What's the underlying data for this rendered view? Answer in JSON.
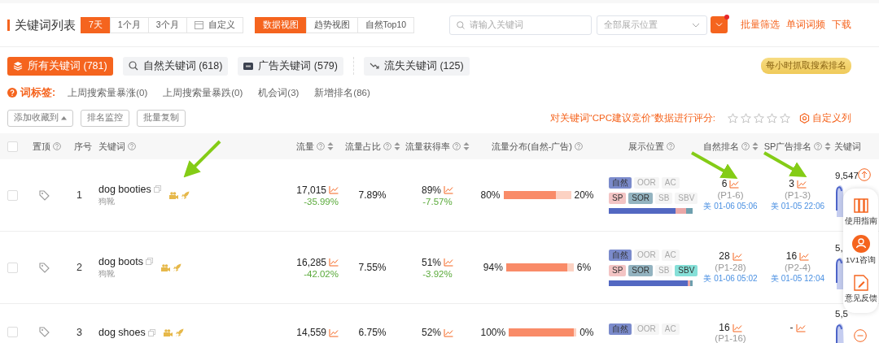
{
  "header": {
    "title": "关键词列表",
    "date_tabs": [
      {
        "label": "7天",
        "selected": true
      },
      {
        "label": "1个月",
        "selected": false
      },
      {
        "label": "3个月",
        "selected": false
      },
      {
        "label": "自定义",
        "selected": false,
        "kind": "calendar"
      }
    ],
    "view_tabs": [
      {
        "label": "数据视图",
        "selected": true
      },
      {
        "label": "趋势视图",
        "selected": false
      },
      {
        "label": "自然Top10",
        "selected": false
      }
    ],
    "search": {
      "placeholder": "请输入关键词"
    },
    "position_select": {
      "placeholder": "全部展示位置"
    },
    "filter_button": {
      "badge": true
    },
    "links": [
      "批量筛选",
      "单词词频",
      "下载"
    ]
  },
  "categories": [
    {
      "label": "所有关键词 (781)",
      "selected": true,
      "kind": "layers"
    },
    {
      "label": "自然关键词 (618)",
      "selected": false,
      "kind": "search"
    },
    {
      "label": "广告关键词 (579)",
      "selected": false,
      "kind": "ad"
    },
    {
      "label": "流失关键词 (125)",
      "selected": false,
      "kind": "loss"
    }
  ],
  "hourly_badge": "每小时抓取搜索排名",
  "word_tags": {
    "label": "词标签:",
    "items": [
      "上周搜索量暴涨(0)",
      "上周搜索量暴跌(0)",
      "机会词(3)",
      "新增排名(86)"
    ]
  },
  "actions": [
    {
      "label": "添加收藏到",
      "kind": "dropdown"
    },
    {
      "label": "排名监控",
      "kind": "plain"
    },
    {
      "label": "批量复制",
      "kind": "plain"
    }
  ],
  "rating": {
    "label": "对关键词“CPC建议竞价”数据进行评分:",
    "stars": 0
  },
  "custom_columns": "自定义列",
  "table": {
    "select_all": false,
    "columns": [
      {
        "label": "置顶",
        "help": true,
        "sortable": false
      },
      {
        "label": "序号",
        "help": false,
        "sortable": false
      },
      {
        "label": "关键词",
        "help": true,
        "sortable": false
      },
      {
        "label": "流量",
        "help": true,
        "sortable": true
      },
      {
        "label": "流量占比",
        "help": true,
        "sortable": true
      },
      {
        "label": "流量获得率",
        "help": true,
        "sortable": true
      },
      {
        "label": "流量分布(自然-广告)",
        "help": true,
        "sortable": false
      },
      {
        "label": "展示位置",
        "help": true,
        "sortable": false
      },
      {
        "label": "自然排名",
        "help": true,
        "sortable": true
      },
      {
        "label": "SP广告排名",
        "help": true,
        "sortable": true
      },
      {
        "label": "关键词",
        "help": false,
        "sortable": false
      }
    ],
    "rows": [
      {
        "checked": false,
        "index": "1",
        "keyword": "dog booties",
        "translation": "狗靴",
        "traffic": {
          "value": "17,015",
          "change": "-35.99%"
        },
        "traffic_share": "7.89%",
        "acquisition": {
          "value": "89%",
          "change": "-7.57%"
        },
        "distribution": {
          "natural": "80%",
          "ad": "20%",
          "level": 0.8
        },
        "positions": {
          "tags": [
            [
              {
                "label": "自然",
                "on": true,
                "color": "#7b8bcc"
              },
              {
                "label": "OOR",
                "on": false
              },
              {
                "label": "AC",
                "on": false
              }
            ],
            [
              {
                "label": "SP",
                "on": true,
                "color": "#f3c4c4"
              },
              {
                "label": "SOR",
                "on": true,
                "color": "#93b3c0"
              },
              {
                "label": "SB",
                "on": false
              },
              {
                "label": "SBV",
                "on": false
              }
            ]
          ],
          "bar": {
            "color": "#6e9fae",
            "segments": [
              {
                "level": 0.8,
                "color": "#5368c2"
              },
              {
                "level": 0.92,
                "color": "#eaa7a7"
              }
            ]
          }
        },
        "natural_rank": {
          "value": "6",
          "page": "(P1-6)",
          "time": "美 01-06 05:06"
        },
        "sp_rank": {
          "value": "3",
          "page": "(P1-3)",
          "time": "美 01-05 22:06"
        },
        "last": "9,547"
      },
      {
        "checked": false,
        "index": "2",
        "keyword": "dog boots",
        "translation": "狗靴",
        "traffic": {
          "value": "16,285",
          "change": "-42.02%"
        },
        "traffic_share": "7.55%",
        "acquisition": {
          "value": "51%",
          "change": "-3.92%"
        },
        "distribution": {
          "natural": "94%",
          "ad": "6%",
          "level": 0.94
        },
        "positions": {
          "tags": [
            [
              {
                "label": "自然",
                "on": true,
                "color": "#7b8bcc"
              },
              {
                "label": "OOR",
                "on": false
              },
              {
                "label": "AC",
                "on": false
              }
            ],
            [
              {
                "label": "SP",
                "on": true,
                "color": "#f3c4c4"
              },
              {
                "label": "SOR",
                "on": true,
                "color": "#93b3c0"
              },
              {
                "label": "SB",
                "on": false
              },
              {
                "label": "SBV",
                "on": true,
                "color": "#86e0d8"
              }
            ]
          ],
          "bar": {
            "color": "#6e9fae",
            "segments": [
              {
                "level": 0.94,
                "color": "#5368c2"
              },
              {
                "level": 0.97,
                "color": "#eaa7a7"
              }
            ]
          }
        },
        "natural_rank": {
          "value": "28",
          "page": "(P1-28)",
          "time": "美 01-06 05:02"
        },
        "sp_rank": {
          "value": "16",
          "page": "(P2-4)",
          "time": "美 01-05 12:04"
        },
        "last": "5,"
      },
      {
        "checked": false,
        "index": "3",
        "keyword": "dog shoes",
        "traffic": {
          "value": "14,559"
        },
        "traffic_share": "6.75%",
        "acquisition": {
          "value": "52%"
        },
        "distribution": {
          "natural": "100%",
          "ad": "0%",
          "level": 1
        },
        "positions": {
          "tags": [
            [
              {
                "label": "自然",
                "on": true,
                "color": "#7b8bcc"
              },
              {
                "label": "OOR",
                "on": false
              },
              {
                "label": "AC",
                "on": false
              }
            ]
          ]
        },
        "natural_rank": {
          "value": "16",
          "page": "(P1-16)"
        },
        "sp_rank": {
          "value": "-"
        },
        "last": "5,5"
      }
    ]
  },
  "float_panel": {
    "items": [
      {
        "label": "使用指南",
        "kind": "book"
      },
      {
        "label": "1V1咨询",
        "kind": "person"
      },
      {
        "label": "意见反馈",
        "kind": "edit"
      }
    ]
  }
}
